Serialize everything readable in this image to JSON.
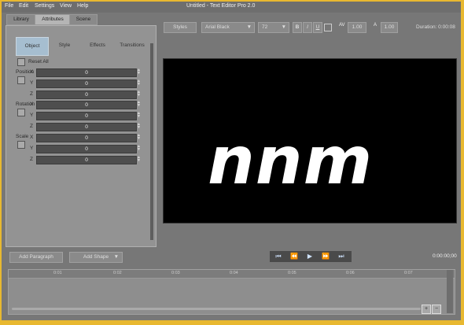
{
  "window": {
    "title": "Untitled - Text Editor Pro 2.0"
  },
  "menu": [
    "File",
    "Edit",
    "Settings",
    "View",
    "Help"
  ],
  "tabs": [
    "Library",
    "Attributes",
    "Scene"
  ],
  "subtabs": [
    "Object",
    "Style",
    "Effects",
    "Transitions"
  ],
  "reset_label": "Reset All",
  "groups": {
    "position": "Position",
    "rotation": "Rotation",
    "scale": "Scale"
  },
  "fields": [
    {
      "axis": "X",
      "value": "0"
    },
    {
      "axis": "Y",
      "value": "0"
    },
    {
      "axis": "Z",
      "value": "0"
    },
    {
      "axis": "X",
      "value": "0"
    },
    {
      "axis": "Y",
      "value": "0"
    },
    {
      "axis": "Z",
      "value": "0"
    },
    {
      "axis": "X",
      "value": "0"
    },
    {
      "axis": "Y",
      "value": "0"
    },
    {
      "axis": "Z",
      "value": "0"
    }
  ],
  "toolbar": {
    "styles": "Styles",
    "font": "Arial Black",
    "size": "72",
    "bold": "B",
    "italic": "I",
    "underline": "U",
    "av_label": "AV",
    "spacing": "1.00",
    "line_label": "A",
    "line_spacing": "1.00",
    "duration": "Duration: 0:00:08"
  },
  "preview_text": "nnm",
  "buttons": {
    "add_paragraph": "Add Paragraph",
    "add_shape": "Add Shape"
  },
  "timecode": "0:00:00;00",
  "timeline_ticks": [
    "0:01",
    "0:02",
    "0:03",
    "0:04",
    "0:05",
    "0:06",
    "0:07"
  ]
}
